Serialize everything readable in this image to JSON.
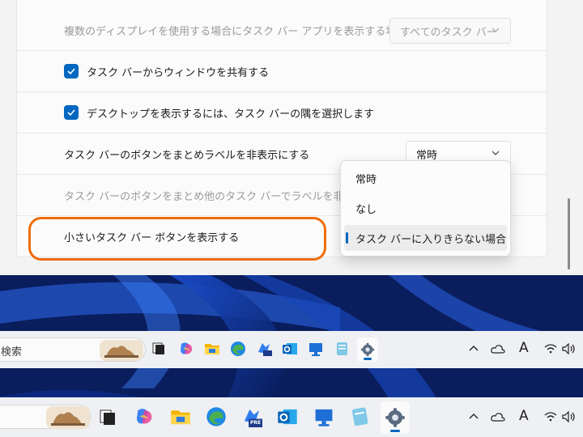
{
  "settings": {
    "rows": [
      {
        "label": "複数のディスプレイを使用する場合にタスク バー アプリを表示する場所",
        "select_value": "すべてのタスク バー",
        "disabled": true
      },
      {
        "label": "タスク バーからウィンドウを共有する",
        "checked": true
      },
      {
        "label": "デスクトップを表示するには、タスク バーの隅を選択します",
        "checked": true
      },
      {
        "label": "タスク バーのボタンをまとめラベルを非表示にする",
        "select_value": "常時"
      },
      {
        "label": "タスク バーのボタンをまとめ他のタスク バーでラベルを非表示にす",
        "disabled": true
      },
      {
        "label": "小さいタスク バー ボタンを表示する"
      }
    ],
    "dropdown_options": [
      "常時",
      "なし",
      "タスク バーに入りきらない場合"
    ],
    "selected_option": "タスク バーに入りきらない場合",
    "highlight_color": "#ef6c0a",
    "accent": "#0067c0"
  },
  "taskbar_top": {
    "search_text": "検索",
    "apps": [
      "task-view-icon",
      "copilot-icon",
      "file-explorer-icon",
      "edge-icon",
      "copilot-pre-icon",
      "outlook-icon",
      "remote-desktop-icon",
      "notepad-icon",
      "settings-icon"
    ],
    "tray": {
      "ime": "A"
    }
  },
  "taskbar_bottom": {
    "apps": [
      "task-view-icon",
      "copilot-icon",
      "file-explorer-icon",
      "edge-icon",
      "copilot-pre-icon",
      "outlook-icon",
      "remote-desktop-icon",
      "notepad-icon",
      "settings-icon"
    ],
    "tray": {
      "ime": "A",
      "pre_badge": "PRE"
    }
  }
}
